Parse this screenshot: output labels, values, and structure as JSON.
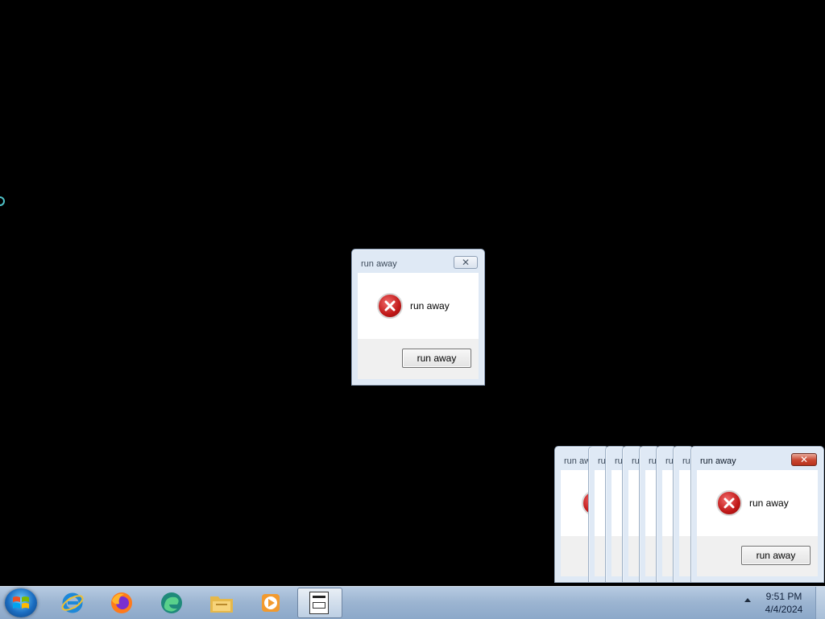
{
  "dialogs": {
    "center": {
      "title": "run away",
      "message": "run away",
      "button": "run away",
      "close": "✕"
    },
    "stack_title_partial": "run away",
    "stack_title_cut": "ru",
    "front": {
      "title": "run away",
      "message": "run away",
      "button": "run away",
      "close": "✕"
    }
  },
  "taskbar": {
    "icons": [
      "start-orb",
      "internet-explorer-icon",
      "firefox-icon",
      "edge-icon",
      "file-explorer-icon",
      "media-player-icon",
      "script-app-icon"
    ],
    "clock": {
      "time": "9:51 PM",
      "date": "4/4/2024"
    }
  },
  "colors": {
    "desktop": "#000000",
    "error_red": "#c01818",
    "taskbar": "#9bb4d1"
  }
}
